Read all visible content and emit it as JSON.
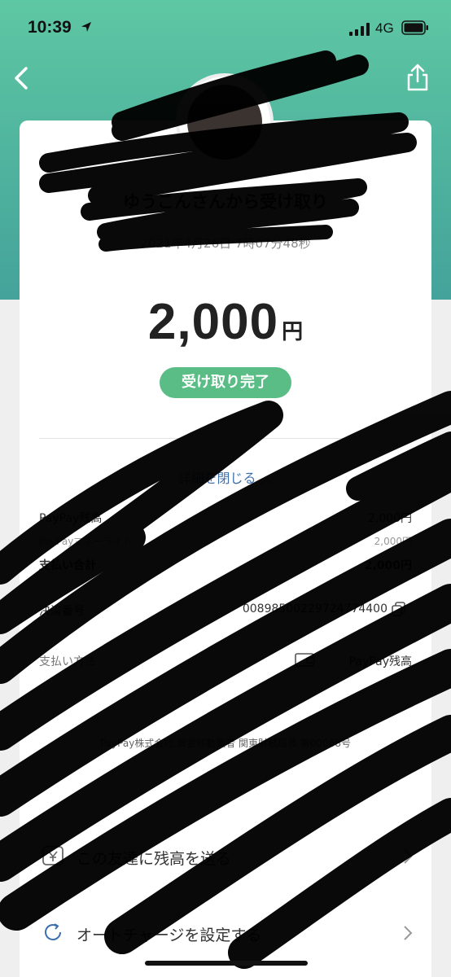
{
  "status_bar": {
    "time": "10:39",
    "network": "4G"
  },
  "header": {
    "back_icon": "chevron-left-icon",
    "share_icon": "share-icon"
  },
  "transaction": {
    "title": "ゆうこんさんから受け取り",
    "datetime": "2021年4月26日 7時07分48秒",
    "amount": "2,000",
    "currency": "円",
    "status_badge": "受け取り完了"
  },
  "details": {
    "toggle_label": "詳細を閉じる",
    "rows": [
      {
        "label": "PayPay残高",
        "value": "2,000円"
      },
      {
        "label": "PayPayマネーライト",
        "value": "2,000円"
      },
      {
        "label": "支払い合計",
        "value": "2,000円"
      },
      {
        "label": "決済番号",
        "value": "00898500229724774400"
      },
      {
        "label": "支払い方法",
        "value": "PayPay残高"
      }
    ],
    "legal_text": "PayPay株式会社 資金移動業者 関東財務局長 第00068号"
  },
  "actions": [
    {
      "label": "この友達に残高を送る",
      "icon": "yen-wallet-icon"
    },
    {
      "label": "オートチャージを設定する",
      "icon": "refresh-icon"
    }
  ],
  "colors": {
    "header_green": "#5ec7a3",
    "badge_green": "#5bbd86",
    "link_blue": "#3d6fae",
    "redaction": "#000000"
  }
}
